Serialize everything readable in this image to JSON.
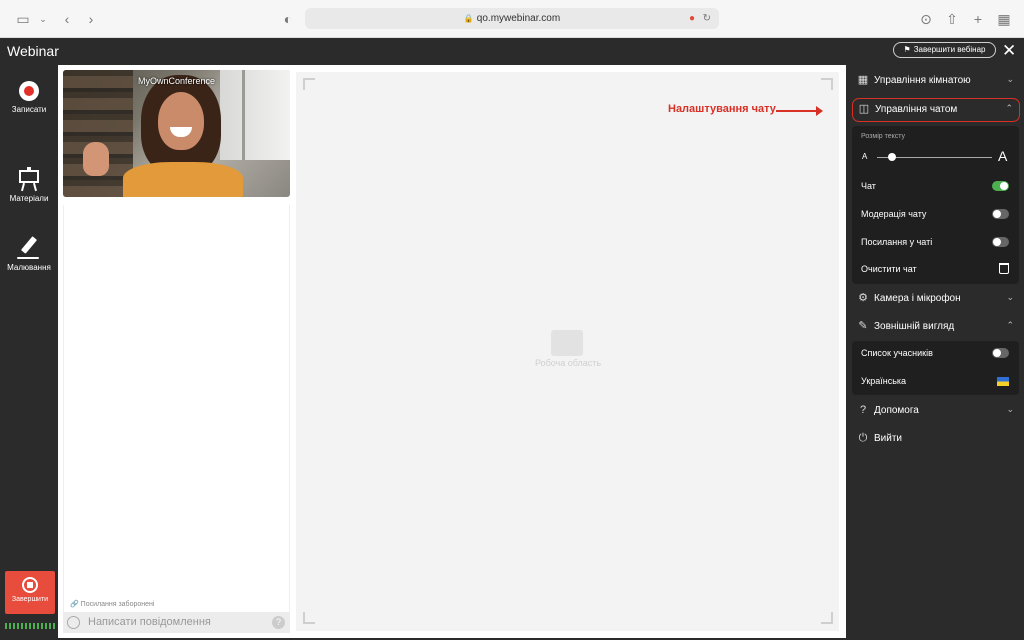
{
  "browser": {
    "url": "qo.mywebinar.com"
  },
  "app": {
    "title": "Webinar",
    "finish_webinar_label": "Завершити вебінар"
  },
  "left_toolbar": {
    "record_label": "Записати",
    "materials_label": "Матеріали",
    "drawing_label": "Малювання",
    "finish_label": "Завершити"
  },
  "video": {
    "participant_label": "MyOwnConference"
  },
  "chat": {
    "links_forbidden": "Посилання заборонені",
    "input_placeholder": "Написати повідомлення"
  },
  "workspace": {
    "label": "Робоча область"
  },
  "annotation": {
    "text": "Налаштування чату",
    "color": "#d93025"
  },
  "side_panel": {
    "room_management": "Управління кімнатою",
    "chat_management": "Управління чатом",
    "text_size_label": "Розмір тексту",
    "text_size_small": "A",
    "text_size_large": "A",
    "text_size_level": 0.1,
    "chat_settings": [
      {
        "label": "Чат",
        "on": true
      },
      {
        "label": "Модерація чату",
        "on": false
      },
      {
        "label": "Посилання у чаті",
        "on": false
      }
    ],
    "clear_chat": "Очистити чат",
    "camera_mic": "Камера і мікрофон",
    "appearance": "Зовнішній вигляд",
    "participants_list": {
      "label": "Список учасників",
      "on": false
    },
    "language": "Українська",
    "help": "Допомога",
    "logout": "Вийти"
  }
}
